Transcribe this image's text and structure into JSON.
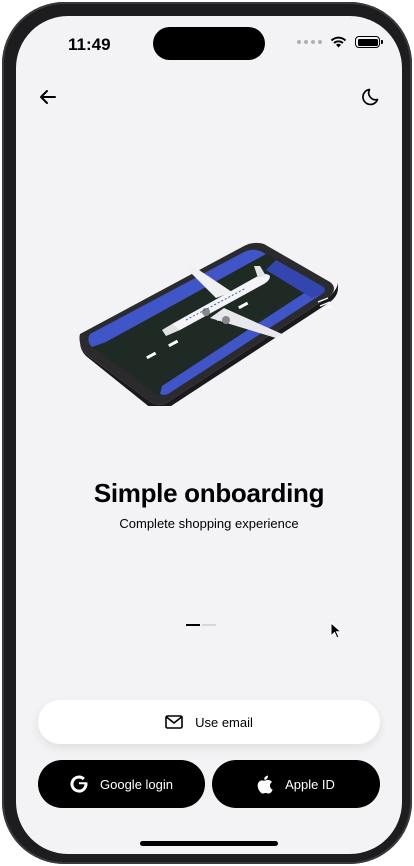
{
  "status_bar": {
    "time": "11:49"
  },
  "icons": {
    "back": "arrow-left-icon",
    "theme": "moon-icon",
    "email": "mail-icon",
    "google": "google-icon",
    "apple": "apple-icon"
  },
  "onboarding": {
    "title": "Simple onboarding",
    "subtitle": "Complete shopping experience",
    "pager": {
      "current": 1,
      "total": 2
    }
  },
  "actions": {
    "email_label": "Use email",
    "google_label": "Google login",
    "apple_label": "Apple ID"
  },
  "colors": {
    "background": "#f3f2f4",
    "button_dark": "#000000",
    "illustration_blue": "#3f55c8"
  }
}
